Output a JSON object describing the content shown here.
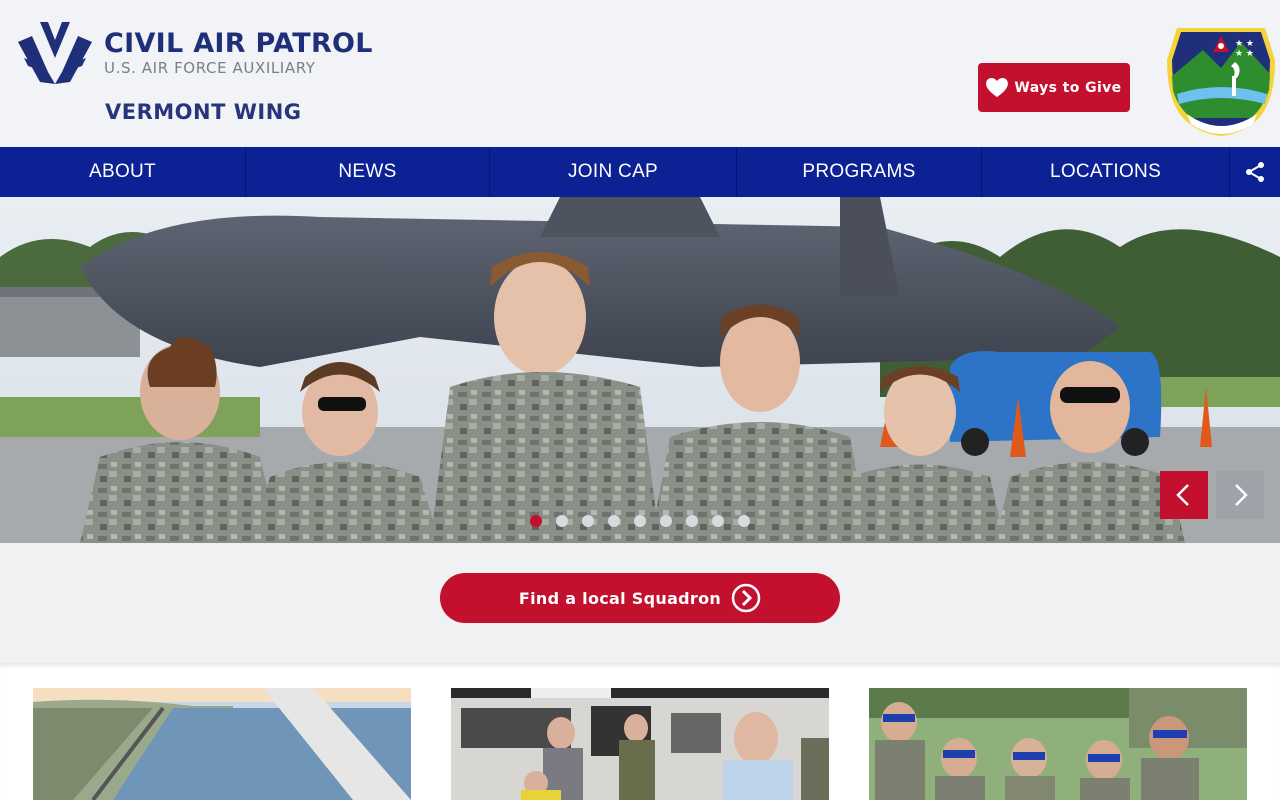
{
  "brand": {
    "title": "CIVIL AIR PATROL",
    "subtitle": "U.S. AIR FORCE AUXILIARY",
    "wing": "VERMONT WING",
    "seal_text": "VERMONT WING",
    "primary_color": "#0c2194",
    "accent_color": "#c3102f"
  },
  "header": {
    "give_label": "Ways to Give"
  },
  "nav": {
    "items": [
      {
        "label": "ABOUT"
      },
      {
        "label": "NEWS"
      },
      {
        "label": "JOIN CAP"
      },
      {
        "label": "PROGRAMS"
      },
      {
        "label": "LOCATIONS"
      }
    ],
    "share_icon": "share-icon"
  },
  "hero": {
    "slide_count": 9,
    "active_slide": 1,
    "prev_icon": "chevron-left-icon",
    "next_icon": "chevron-right-icon"
  },
  "cta": {
    "label": "Find a local Squadron",
    "icon": "chevron-right-circle-icon"
  },
  "cards": [
    {
      "image": "aerial-coastline-photo"
    },
    {
      "image": "workshop-visit-photo"
    },
    {
      "image": "cadets-eclipse-glasses-photo"
    }
  ]
}
